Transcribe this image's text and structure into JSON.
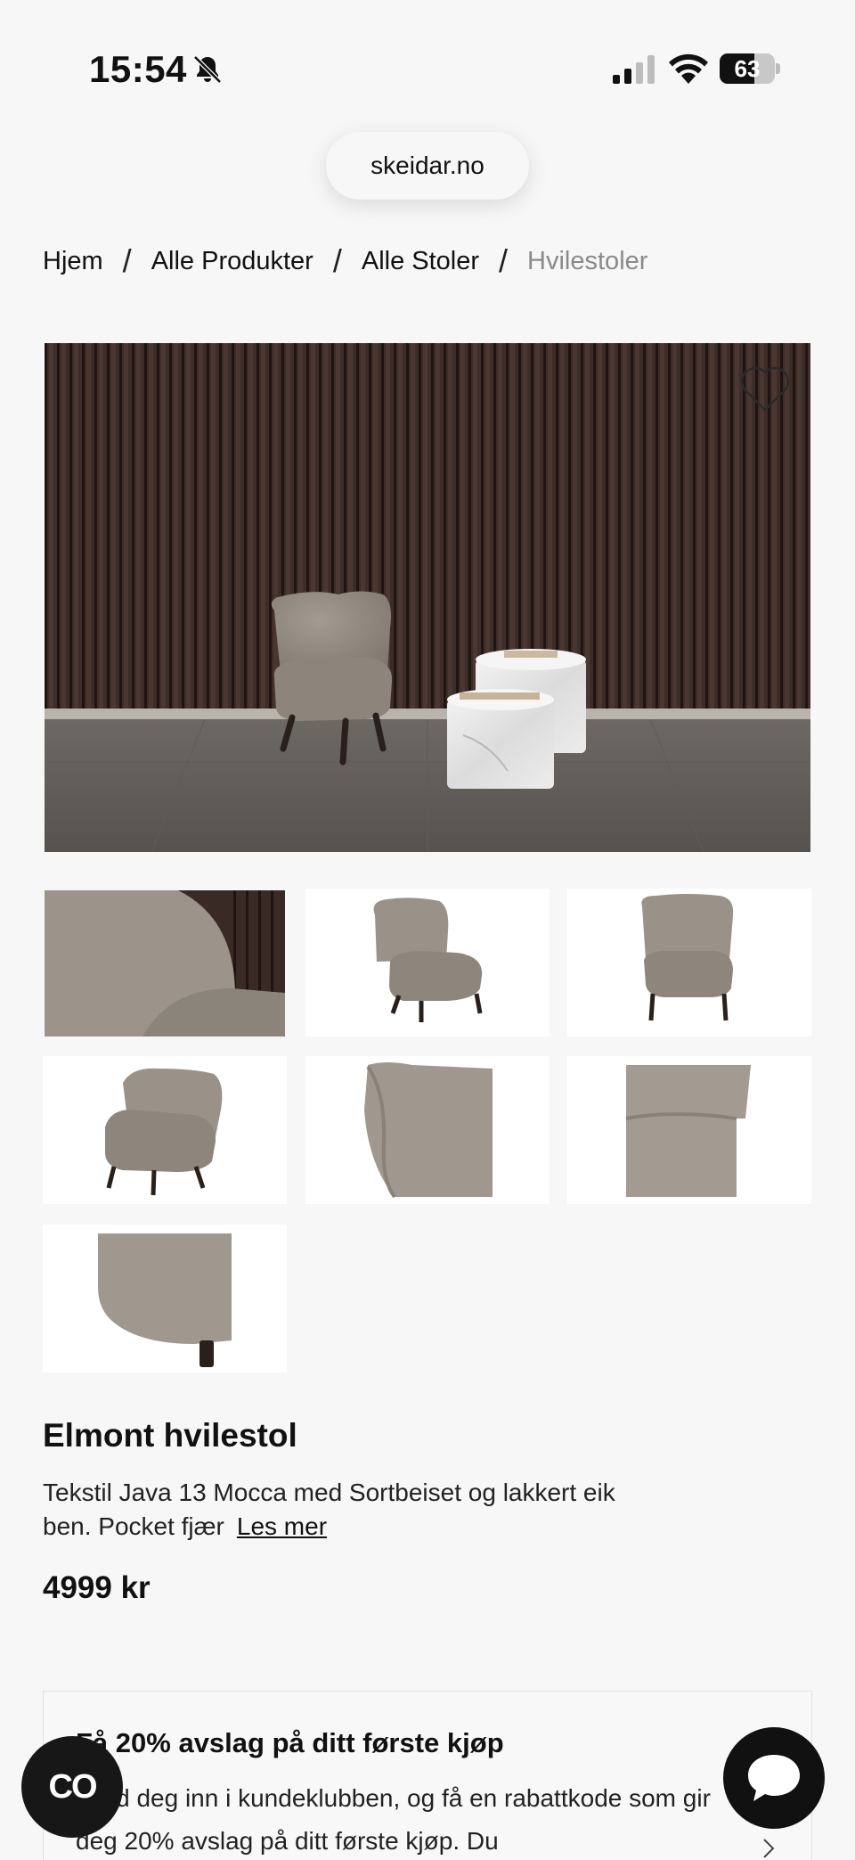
{
  "status_bar": {
    "time": "15:54",
    "battery": "63",
    "battery_level": 0.63
  },
  "browser": {
    "url": "skeidar.no"
  },
  "breadcrumb": {
    "items": [
      "Hjem",
      "Alle Produkter",
      "Alle Stoler",
      "Hvilestoler"
    ],
    "separator": "/"
  },
  "product": {
    "title": "Elmont hvilestol",
    "description": "Tekstil Java 13 Mocca med Sortbeiset og lakkert eik ben. Pocket fjær",
    "read_more": "Les mer",
    "price": "4999 kr"
  },
  "promo": {
    "title": "Få 20% avslag på ditt første kjøp",
    "body": "Meld deg inn i kundeklubben, og få en rabattkode som gir deg 20% avslag på ditt første kjøp. Du"
  },
  "floating": {
    "loyalty_label": "CO"
  },
  "icons": {
    "bell": "bell-slash-icon",
    "signal": "cellular-signal-icon",
    "wifi": "wifi-icon",
    "heart": "heart-outline-icon",
    "chat": "chat-bubble-icon",
    "chevron": "chevron-right-icon"
  },
  "colors": {
    "background": "#f7f7f7",
    "text": "#111111",
    "muted": "#8a8a8a",
    "dark_button": "#111111"
  }
}
